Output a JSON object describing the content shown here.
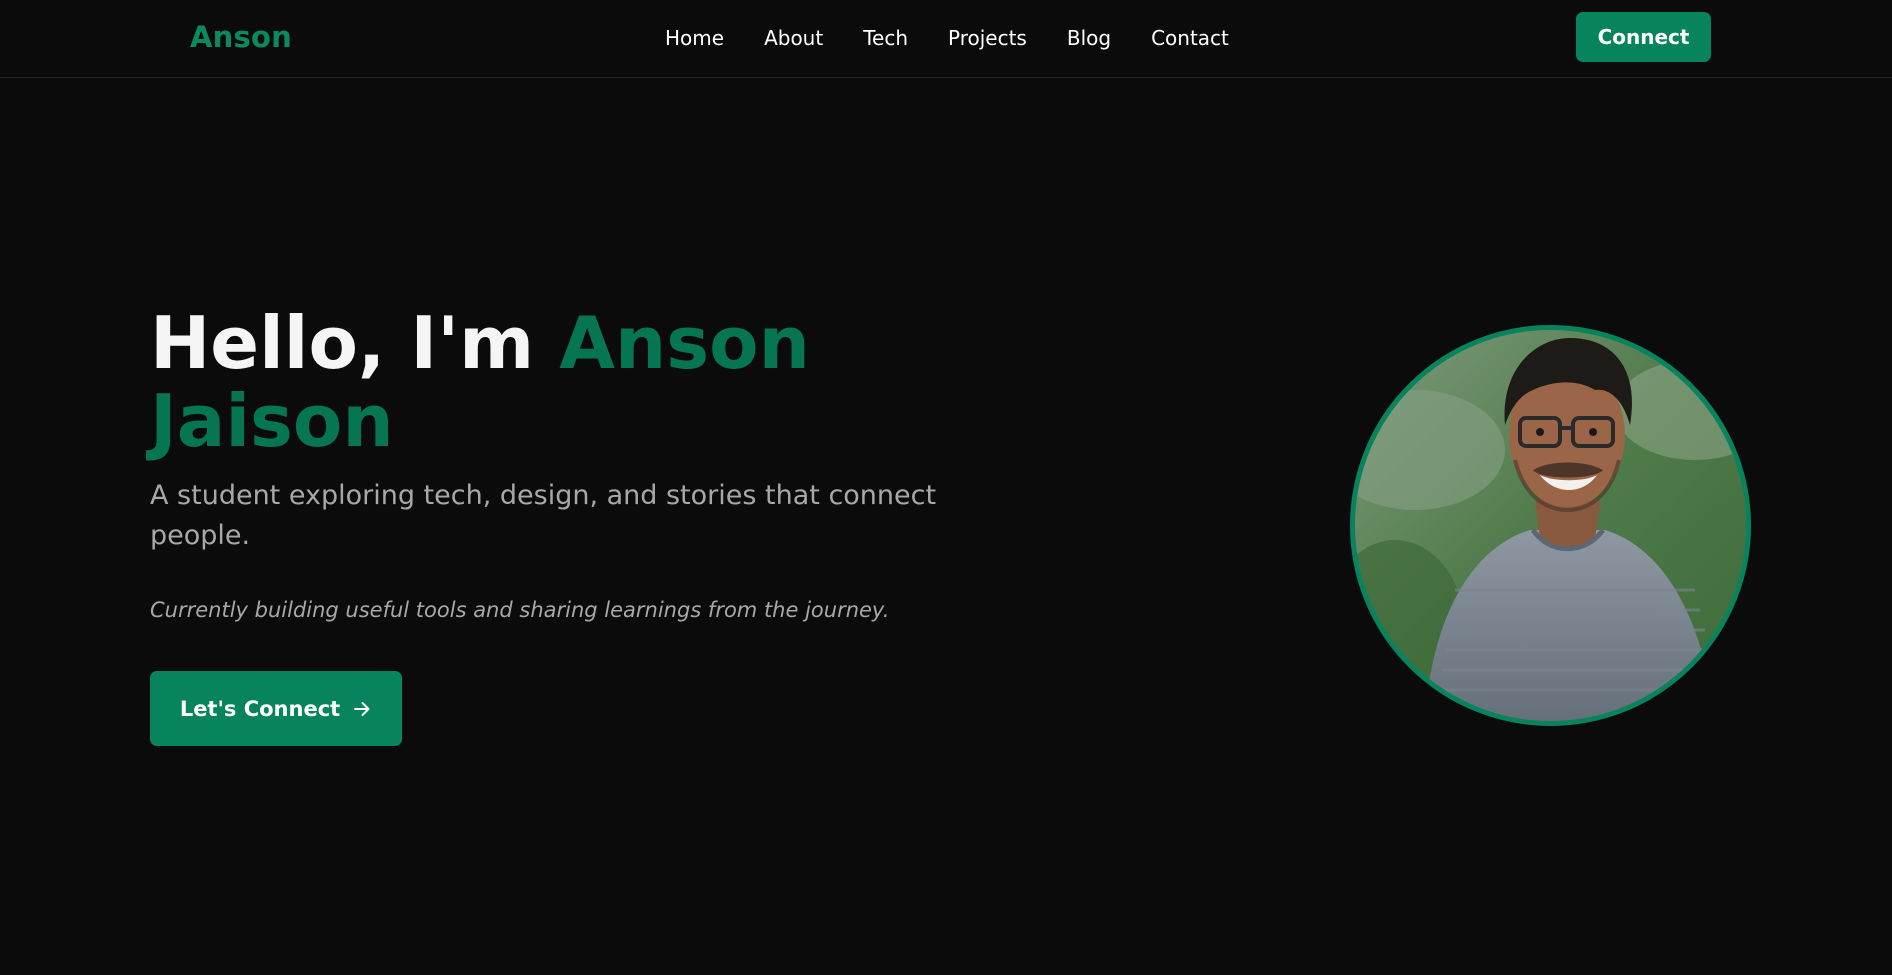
{
  "header": {
    "brand": "Anson",
    "nav": [
      {
        "label": "Home"
      },
      {
        "label": "About"
      },
      {
        "label": "Tech"
      },
      {
        "label": "Projects"
      },
      {
        "label": "Blog"
      },
      {
        "label": "Contact"
      }
    ],
    "connect_label": "Connect"
  },
  "hero": {
    "greeting": "Hello, I'm",
    "name_first": "Anson",
    "name_last": "Jaison",
    "subtitle": "A student exploring tech, design, and stories that connect people.",
    "note": "Currently building useful tools and sharing learnings from the journey.",
    "cta_label": "Let's Connect",
    "cta_icon": "arrow-right-icon",
    "portrait": "profile-photo"
  },
  "colors": {
    "background": "#0b0b0b",
    "accent": "#07835d",
    "accent_text": "#057552",
    "muted_text": "#a8a8a8"
  }
}
